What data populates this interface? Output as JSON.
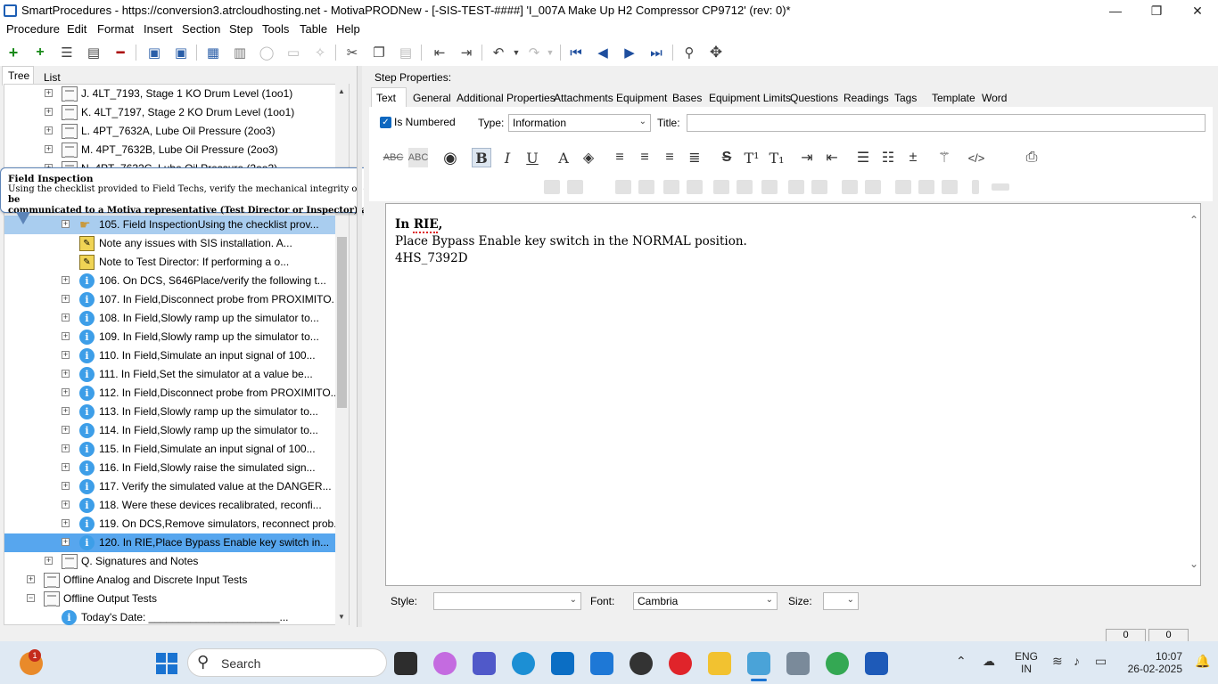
{
  "window": {
    "title": "SmartProcedures - https://conversion3.atrcloudhosting.net - MotivaPRODNew - [-SIS-TEST-####] 'I_007A Make Up H2 Compressor CP9712' (rev: 0)*",
    "minimize": "—",
    "maximize": "❐",
    "close": "✕"
  },
  "menu": [
    "Procedure",
    "Edit",
    "Format",
    "Insert",
    "Section",
    "Step",
    "Tools",
    "Table",
    "Help"
  ],
  "left_tabs": {
    "tree": "Tree",
    "list": "List"
  },
  "tree_rows": [
    {
      "label": "J. 4LT_7193, Stage 1 KO Drum Level (1oo1)",
      "icon": "doc-icon"
    },
    {
      "label": "K. 4LT_7197, Stage 2 KO Drum Level (1oo1)",
      "icon": "doc-icon"
    },
    {
      "label": "L. 4PT_7632A, Lube Oil Pressure (2oo3)",
      "icon": "doc-icon"
    },
    {
      "label": "M. 4PT_7632B, Lube Oil Pressure (2oo3)",
      "icon": "doc-icon"
    },
    {
      "label": "N. 4PT_7632C, Lube Oil Pressure (2oo3)",
      "icon": "doc-icon"
    }
  ],
  "tooltip": {
    "title": "Field Inspection",
    "line1": "Using the checklist provided to Field Techs, verify the mechanical integrity of each of these devices.",
    "line1_bold": "Any issues will be",
    "line2": "communicated to a Motiva representative (Test Director or Inspector) at the time of the tests."
  },
  "step_rows": [
    {
      "label": "105. Field InspectionUsing the checklist prov...",
      "icon": "hand-icon",
      "expand": true
    },
    {
      "label": "Note any issues with SIS installation. A...",
      "icon": "note-icon",
      "expand": false
    },
    {
      "label": "Note to Test Director: If performing a o...",
      "icon": "note-icon",
      "expand": false
    },
    {
      "label": "106. On DCS, S646Place/verify the following t...",
      "icon": "info-icon",
      "expand": true
    },
    {
      "label": "107. In Field,Disconnect probe from PROXIMITO...",
      "icon": "info-icon",
      "expand": true
    },
    {
      "label": "108. In Field,Slowly ramp up the simulator to...",
      "icon": "info-icon",
      "expand": true
    },
    {
      "label": "109. In Field,Slowly ramp up the simulator to...",
      "icon": "info-icon",
      "expand": true
    },
    {
      "label": "110. In Field,Simulate an input signal of 100...",
      "icon": "info-icon",
      "expand": true
    },
    {
      "label": "111. In Field,Set the simulator at a value be...",
      "icon": "info-icon",
      "expand": true
    },
    {
      "label": "112. In Field,Disconnect probe from PROXIMITO...",
      "icon": "info-icon",
      "expand": true
    },
    {
      "label": "113. In Field,Slowly ramp up the simulator to...",
      "icon": "info-icon",
      "expand": true
    },
    {
      "label": "114. In Field,Slowly ramp up the simulator to...",
      "icon": "info-icon",
      "expand": true
    },
    {
      "label": "115. In Field,Simulate an input signal of 100...",
      "icon": "info-icon",
      "expand": true
    },
    {
      "label": "116. In Field,Slowly raise the simulated sign...",
      "icon": "info-icon",
      "expand": true
    },
    {
      "label": "117. Verify the simulated value at the DANGER...",
      "icon": "info-icon",
      "expand": true
    },
    {
      "label": "118. Were these devices recalibrated, reconfi...",
      "icon": "info-icon",
      "expand": true
    },
    {
      "label": "119. On DCS,Remove simulators, reconnect prob...",
      "icon": "info-icon",
      "expand": true
    },
    {
      "label": "120. In RIE,Place Bypass Enable key switch in...",
      "icon": "info-icon",
      "expand": true
    }
  ],
  "tail_rows": [
    {
      "label": "Q. Signatures and Notes",
      "expand": "+"
    },
    {
      "label": "Offline Analog and Discrete Input Tests",
      "expand": "+"
    },
    {
      "label": "Offline Output Tests",
      "expand": "−"
    },
    {
      "label": "Today's Date: ______________________..."
    }
  ],
  "step_properties": {
    "heading": "Step Properties:",
    "tabs": [
      "Text",
      "General",
      "Additional Properties",
      "Attachments",
      "Equipment",
      "Bases",
      "Equipment Limits",
      "Questions",
      "Readings",
      "Tags",
      "Template",
      "Word"
    ],
    "is_numbered": "Is Numbered",
    "type_label": "Type:",
    "type_value": "Information",
    "title_label": "Title:",
    "title_value": ""
  },
  "editor": {
    "line1": "In RIE,",
    "line2": "Place Bypass Enable key switch in the NORMAL position.",
    "line3": "4HS_7392D"
  },
  "bottom": {
    "style_label": "Style:",
    "style_value": "",
    "font_label": "Font:",
    "font_value": "Cambria",
    "size_label": "Size:",
    "size_value": ""
  },
  "status": {
    "a": "0",
    "b": "0"
  },
  "taskbar": {
    "search": "Search",
    "lang1": "ENG",
    "lang2": "IN",
    "time": "10:07",
    "date": "26-02-2025",
    "weather_badge": "1"
  }
}
